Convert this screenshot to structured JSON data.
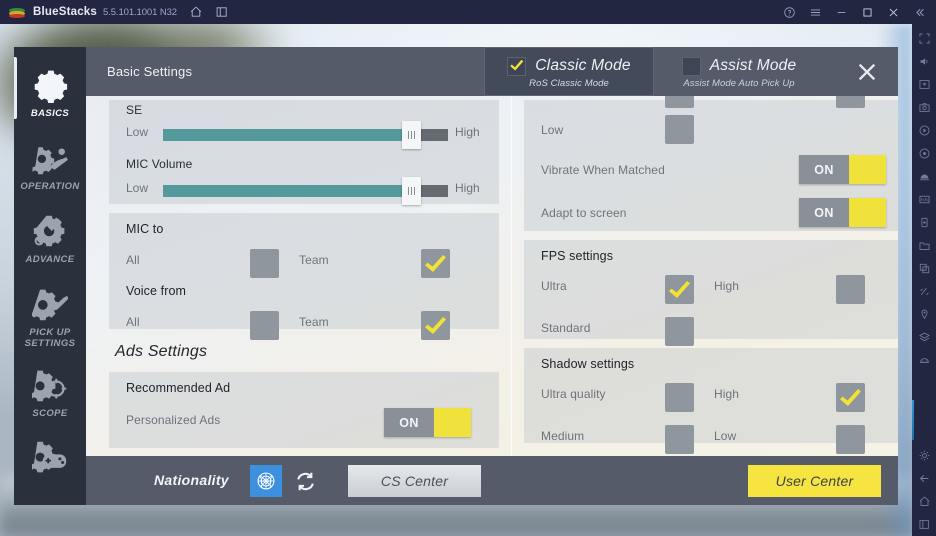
{
  "window": {
    "app_name": "BlueStacks",
    "version": "5.5.101.1001 N32",
    "titlebar_icons": [
      "home-icon",
      "multi-instance-icon"
    ],
    "controls": [
      "help-icon",
      "menu-icon",
      "minimize-icon",
      "maximize-icon",
      "close-icon",
      "collapse-icon"
    ],
    "sidebar_icons": [
      "fullscreen-icon",
      "volume-icon",
      "keymapping-icon",
      "screenshot-icon",
      "record-icon",
      "macro-icon",
      "eco-mode-icon",
      "multi-instance-manager-icon",
      "rotate-icon",
      "media-folder-icon",
      "copy-paste-icon",
      "shake-icon",
      "location-icon",
      "layers-icon",
      "game-guide-icon",
      "settings-icon",
      "back-icon",
      "home-nav-icon",
      "recents-icon"
    ]
  },
  "dialog": {
    "title": "Basic Settings",
    "close_label": "✕",
    "modes": [
      {
        "name": "Classic Mode",
        "sub": "RoS Classic Mode",
        "selected": true
      },
      {
        "name": "Assist Mode",
        "sub": "Assist Mode Auto Pick Up",
        "selected": false
      }
    ]
  },
  "rail": {
    "items": [
      {
        "label": "BASICS",
        "icon": "gear-icon",
        "active": true
      },
      {
        "label": "OPERATION",
        "icon": "joystick-gear-icon",
        "active": false
      },
      {
        "label": "ADVANCE",
        "icon": "wrench-gear-icon",
        "active": false
      },
      {
        "label": "PICK UP\nSETTINGS",
        "label_line1": "PICK UP",
        "label_line2": "SETTINGS",
        "icon": "hand-gear-icon",
        "active": false
      },
      {
        "label": "SCOPE",
        "icon": "scope-gear-icon",
        "active": false
      },
      {
        "label": "",
        "icon": "gamepad-gear-icon",
        "active": false
      }
    ]
  },
  "left_column": {
    "audio_card": {
      "se": {
        "label": "SE",
        "min_label": "Low",
        "max_label": "High",
        "value_percent": 87
      },
      "mic_volume": {
        "label": "MIC Volume",
        "min_label": "Low",
        "max_label": "High",
        "value_percent": 87
      }
    },
    "mic_card": {
      "mic_to": {
        "title": "MIC to",
        "option_left": "All",
        "option_left_checked": false,
        "option_right": "Team",
        "option_right_checked": true
      },
      "voice_from": {
        "title": "Voice from",
        "option_left": "All",
        "option_left_checked": false,
        "option_right": "Team",
        "option_right_checked": true
      }
    },
    "ads_section": {
      "title": "Ads Settings",
      "card_title": "Recommended Ad",
      "row_label": "Personalized Ads",
      "toggle_state": "ON"
    }
  },
  "right_column": {
    "top_card": {
      "partial_row_label": "Low",
      "partial_row_checked": false,
      "vibrate": {
        "label": "Vibrate When Matched",
        "toggle_state": "ON"
      },
      "adapt": {
        "label": "Adapt to screen",
        "toggle_state": "ON"
      }
    },
    "fps_card": {
      "title": "FPS settings",
      "options": [
        {
          "label": "Ultra",
          "checked": true
        },
        {
          "label": "High",
          "checked": false
        },
        {
          "label": "Standard",
          "checked": false
        }
      ]
    },
    "shadow_card": {
      "title": "Shadow settings",
      "options": [
        {
          "label": "Ultra quality",
          "checked": false
        },
        {
          "label": "High",
          "checked": true
        },
        {
          "label": "Medium",
          "checked": false
        },
        {
          "label": "Low",
          "checked": false
        }
      ]
    }
  },
  "footer": {
    "nationality_label": "Nationality",
    "flag_icon": "un-flag-icon",
    "refresh_icon": "refresh-icon",
    "cs_center_label": "CS Center",
    "user_center_label": "User Center"
  },
  "colors": {
    "accent_yellow": "#f6e540",
    "check_yellow": "#f2e233",
    "titlebar": "#222641",
    "dialog_header": "#555b68",
    "rail": "#2b313c",
    "slider_fill": "#54999b",
    "slider_track": "#666b72",
    "flag_blue": "#3d8fe0"
  }
}
